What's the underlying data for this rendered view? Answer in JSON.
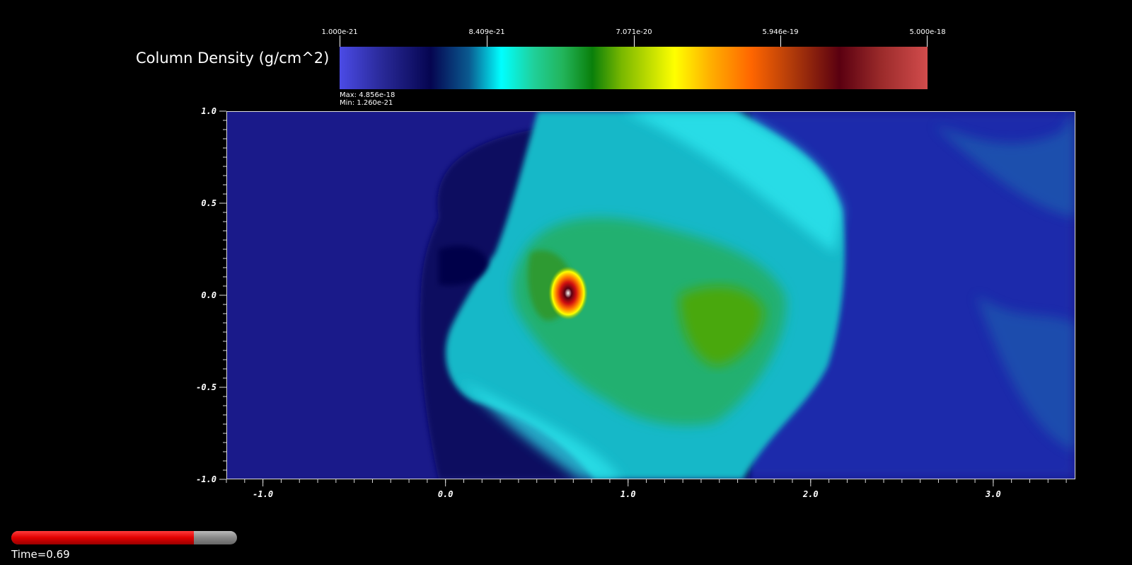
{
  "colorbar": {
    "title": "Column Density (g/cm^2)",
    "ticks": [
      "1.000e-21",
      "8.409e-21",
      "7.071e-20",
      "5.946e-19",
      "5.000e-18"
    ],
    "max_label": "Max:  4.856e-18",
    "min_label": "Min:  1.260e-21"
  },
  "time": {
    "label": "Time=0.69",
    "progress": 0.81
  },
  "colors": {
    "background": "#000000",
    "ambient": "#1a1a8a"
  },
  "chart_data": {
    "type": "heatmap",
    "title": "",
    "xlabel": "",
    "ylabel": "",
    "xlim": [
      -1.2,
      3.45
    ],
    "ylim": [
      -1.0,
      1.0
    ],
    "x_ticks": [
      "-1.0",
      "0.0",
      "1.0",
      "2.0",
      "3.0"
    ],
    "x_tick_values": [
      -1.0,
      0.0,
      1.0,
      2.0,
      3.0
    ],
    "y_ticks": [
      "1.0",
      "0.5",
      "0.0",
      "-0.5",
      "-1.0"
    ],
    "y_tick_values": [
      1.0,
      0.5,
      0.0,
      -0.5,
      -1.0
    ],
    "colormap_range": [
      1e-21,
      5e-18
    ],
    "colorbar_scale": "log",
    "value_max": 4.856e-18,
    "value_min": 1.26e-21
  }
}
